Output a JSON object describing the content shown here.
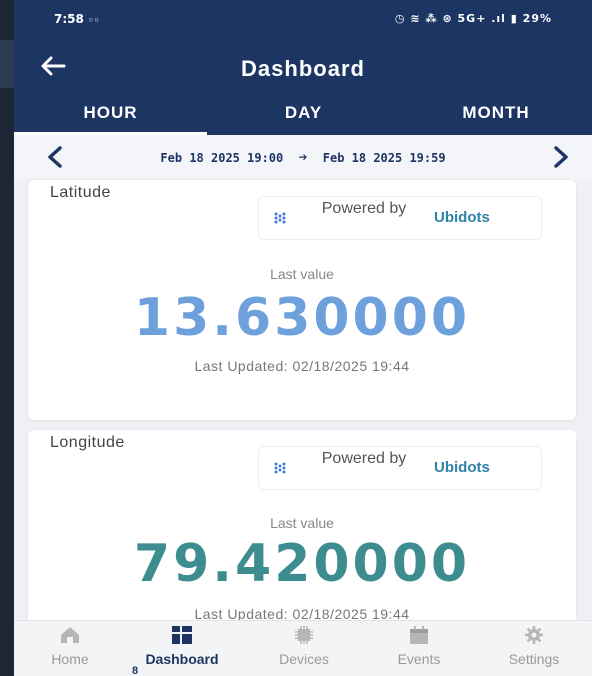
{
  "status": {
    "time": "7:58",
    "time_extra": "◦◦",
    "right": "◷ ≋ ⁂ ⊛ 5G+ .ıl ▮ 29%"
  },
  "appbar": {
    "back_icon": "arrow-left",
    "title": "Dashboard"
  },
  "tabs": [
    {
      "label": "HOUR",
      "active": true
    },
    {
      "label": "DAY",
      "active": false
    },
    {
      "label": "MONTH",
      "active": false
    }
  ],
  "range": {
    "start": "Feb 18 2025 19:00",
    "end": "Feb 18 2025 19:59"
  },
  "cards": [
    {
      "title": "Latitude",
      "powered_by": "Powered by",
      "brand": "Ubidots",
      "last_label": "Last value",
      "value": "13.630000",
      "updated": "Last Updated: 02/18/2025 19:44"
    },
    {
      "title": "Longitude",
      "powered_by": "Powered by",
      "brand": "Ubidots",
      "last_label": "Last value",
      "value": "79.420000",
      "updated": "Last Updated: 02/18/2025 19:44"
    }
  ],
  "nav": [
    {
      "label": "Home",
      "icon": "home-icon"
    },
    {
      "label": "Dashboard",
      "icon": "dashboard-icon",
      "active": true,
      "badge": "8"
    },
    {
      "label": "Devices",
      "icon": "chip-icon"
    },
    {
      "label": "Events",
      "icon": "calendar-icon"
    },
    {
      "label": "Settings",
      "icon": "gear-icon"
    }
  ],
  "colors": {
    "primary": "#1d3563",
    "lat_value": "#6ea0dc",
    "lon_value": "#3d8c8f",
    "brand": "#2f82a8"
  }
}
